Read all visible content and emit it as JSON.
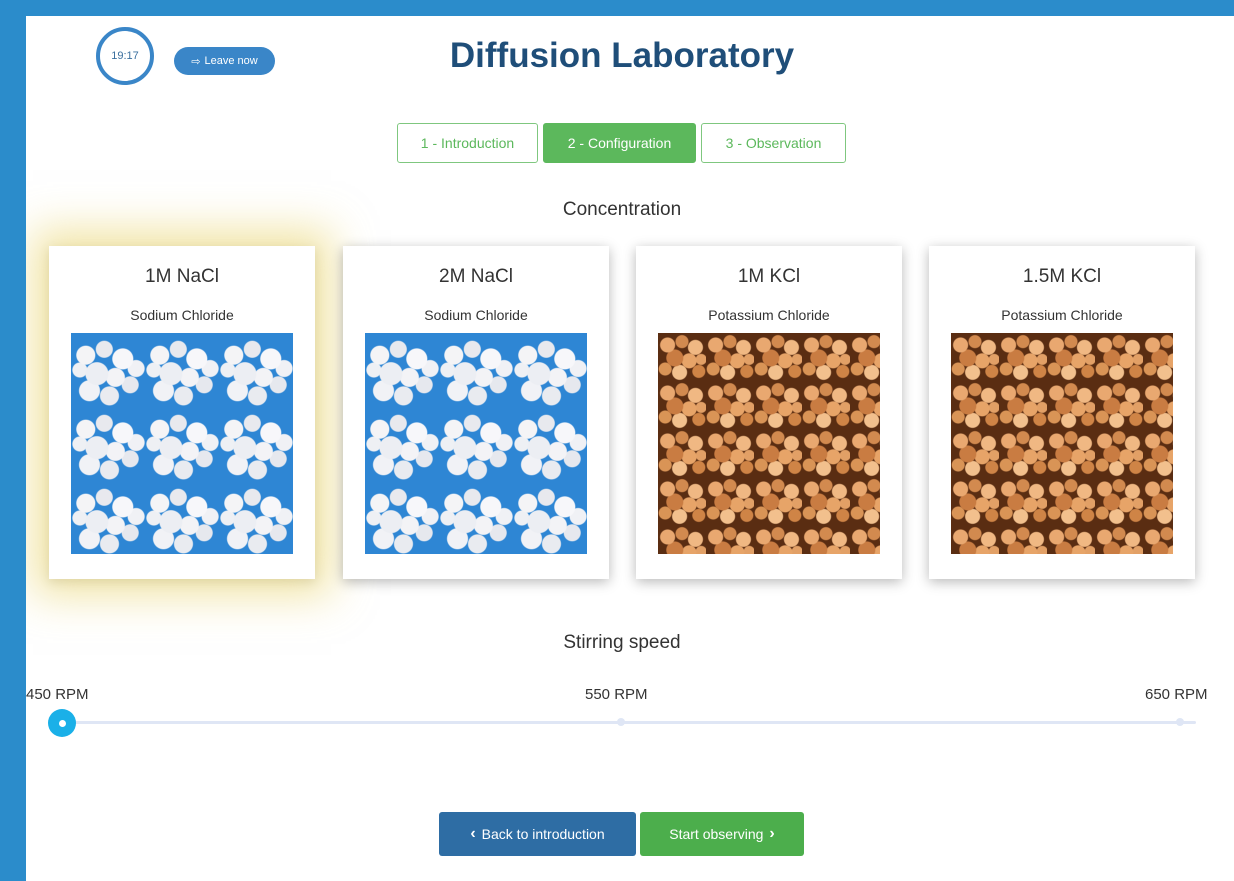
{
  "header": {
    "timer": "19:17",
    "leave_label": "Leave now",
    "title": "Diffusion Laboratory"
  },
  "steps": [
    {
      "label": "1 - Introduction",
      "active": false
    },
    {
      "label": "2 - Configuration",
      "active": true
    },
    {
      "label": "3 - Observation",
      "active": false
    }
  ],
  "concentration": {
    "heading": "Concentration",
    "options": [
      {
        "name": "1M NaCl",
        "compound": "Sodium Chloride",
        "image": "sodium-chloride-crystals",
        "selected": true
      },
      {
        "name": "2M NaCl",
        "compound": "Sodium Chloride",
        "image": "sodium-chloride-crystals",
        "selected": false
      },
      {
        "name": "1M KCl",
        "compound": "Potassium Chloride",
        "image": "potassium-chloride-crystals",
        "selected": false
      },
      {
        "name": "1.5M KCl",
        "compound": "Potassium Chloride",
        "image": "potassium-chloride-crystals",
        "selected": false
      }
    ]
  },
  "stirring": {
    "heading": "Stirring speed",
    "ticks": [
      "450 RPM",
      "550 RPM",
      "650 RPM"
    ],
    "value": "450 RPM"
  },
  "buttons": {
    "back_label": "Back to introduction",
    "start_label": "Start observing"
  },
  "colors": {
    "background": "#2b8ccb",
    "title": "#1f4e79",
    "step_green": "#5cb85c",
    "slider_handle": "#1ab0e8",
    "back_button": "#2e6da4",
    "start_button": "#4cae4c",
    "selection_glow": "#e6cd5a"
  }
}
